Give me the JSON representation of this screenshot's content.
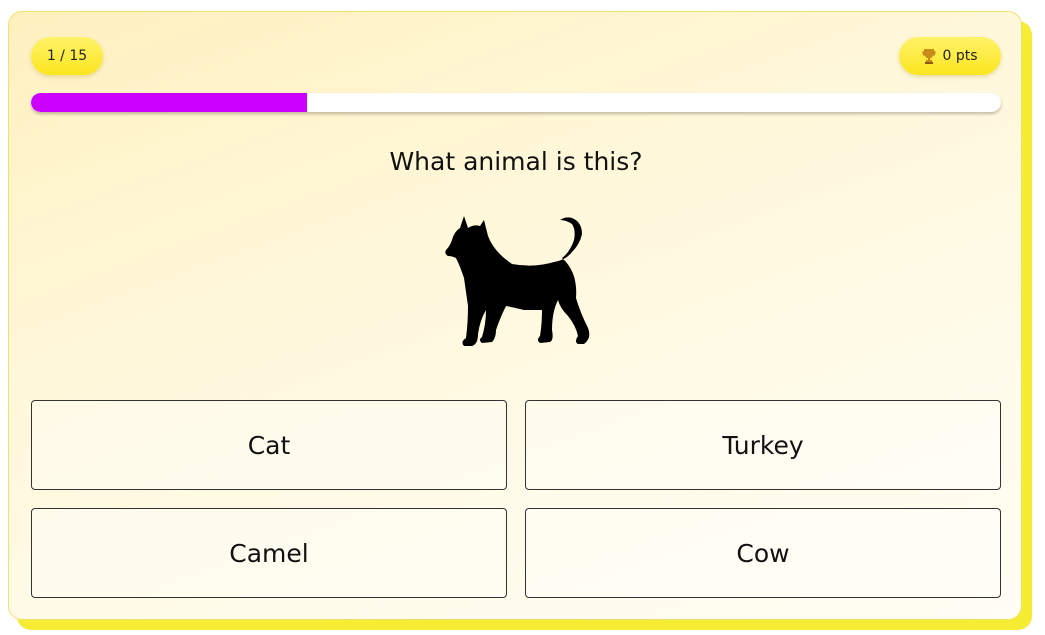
{
  "quiz": {
    "counter": "1 / 15",
    "score": "0 pts",
    "progress": 0.285,
    "question": "What animal is this?",
    "image_icon": "cat-silhouette-icon",
    "answers": [
      "Cat",
      "Turkey",
      "Camel",
      "Cow"
    ]
  },
  "colors": {
    "accent": "#cc00ff",
    "pill": "#fbe51e",
    "card_shadow": "#f6ec33"
  }
}
